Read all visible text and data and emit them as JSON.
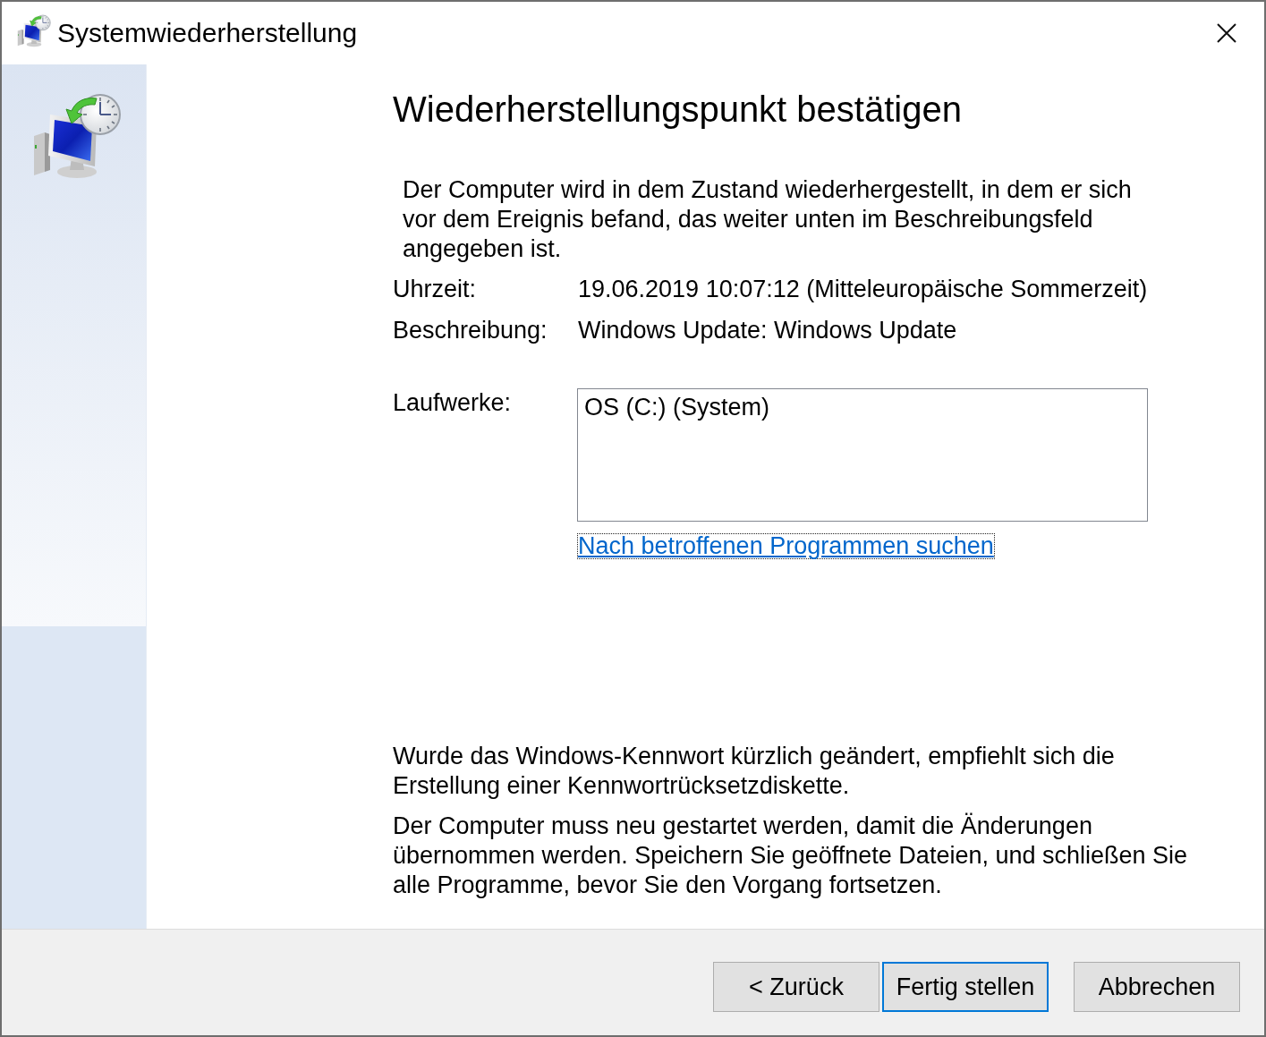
{
  "window": {
    "title": "Systemwiederherstellung"
  },
  "heading": "Wiederherstellungspunkt bestätigen",
  "intro": "Der Computer wird in dem Zustand wiederhergestellt, in dem er sich vor dem Ereignis befand, das weiter unten im Beschreibungsfeld angegeben ist.",
  "details": [
    {
      "label": "Uhrzeit:",
      "value": "19.06.2019 10:07:12 (Mitteleuropäische Sommerzeit)"
    },
    {
      "label": "Beschreibung:",
      "value": "Windows Update: Windows Update"
    }
  ],
  "drives": {
    "label": "Laufwerke:",
    "items": [
      "OS (C:) (System)"
    ]
  },
  "link": {
    "text": "Nach betroffenen Programmen suchen",
    "focused": true
  },
  "notes": [
    "Wurde das Windows-Kennwort kürzlich geändert, empfiehlt sich die Erstellung einer Kennwortrücksetzdiskette.",
    "Der Computer muss neu gestartet werden, damit die Änderungen übernommen werden. Speichern Sie geöffnete Dateien, und schließen Sie alle Programme, bevor Sie den Vorgang fortsetzen."
  ],
  "buttons": [
    {
      "label": "< Zurück",
      "focused": false
    },
    {
      "label": "Fertig stellen",
      "focused": true
    },
    {
      "label": "Abbrechen",
      "focused": false
    }
  ]
}
